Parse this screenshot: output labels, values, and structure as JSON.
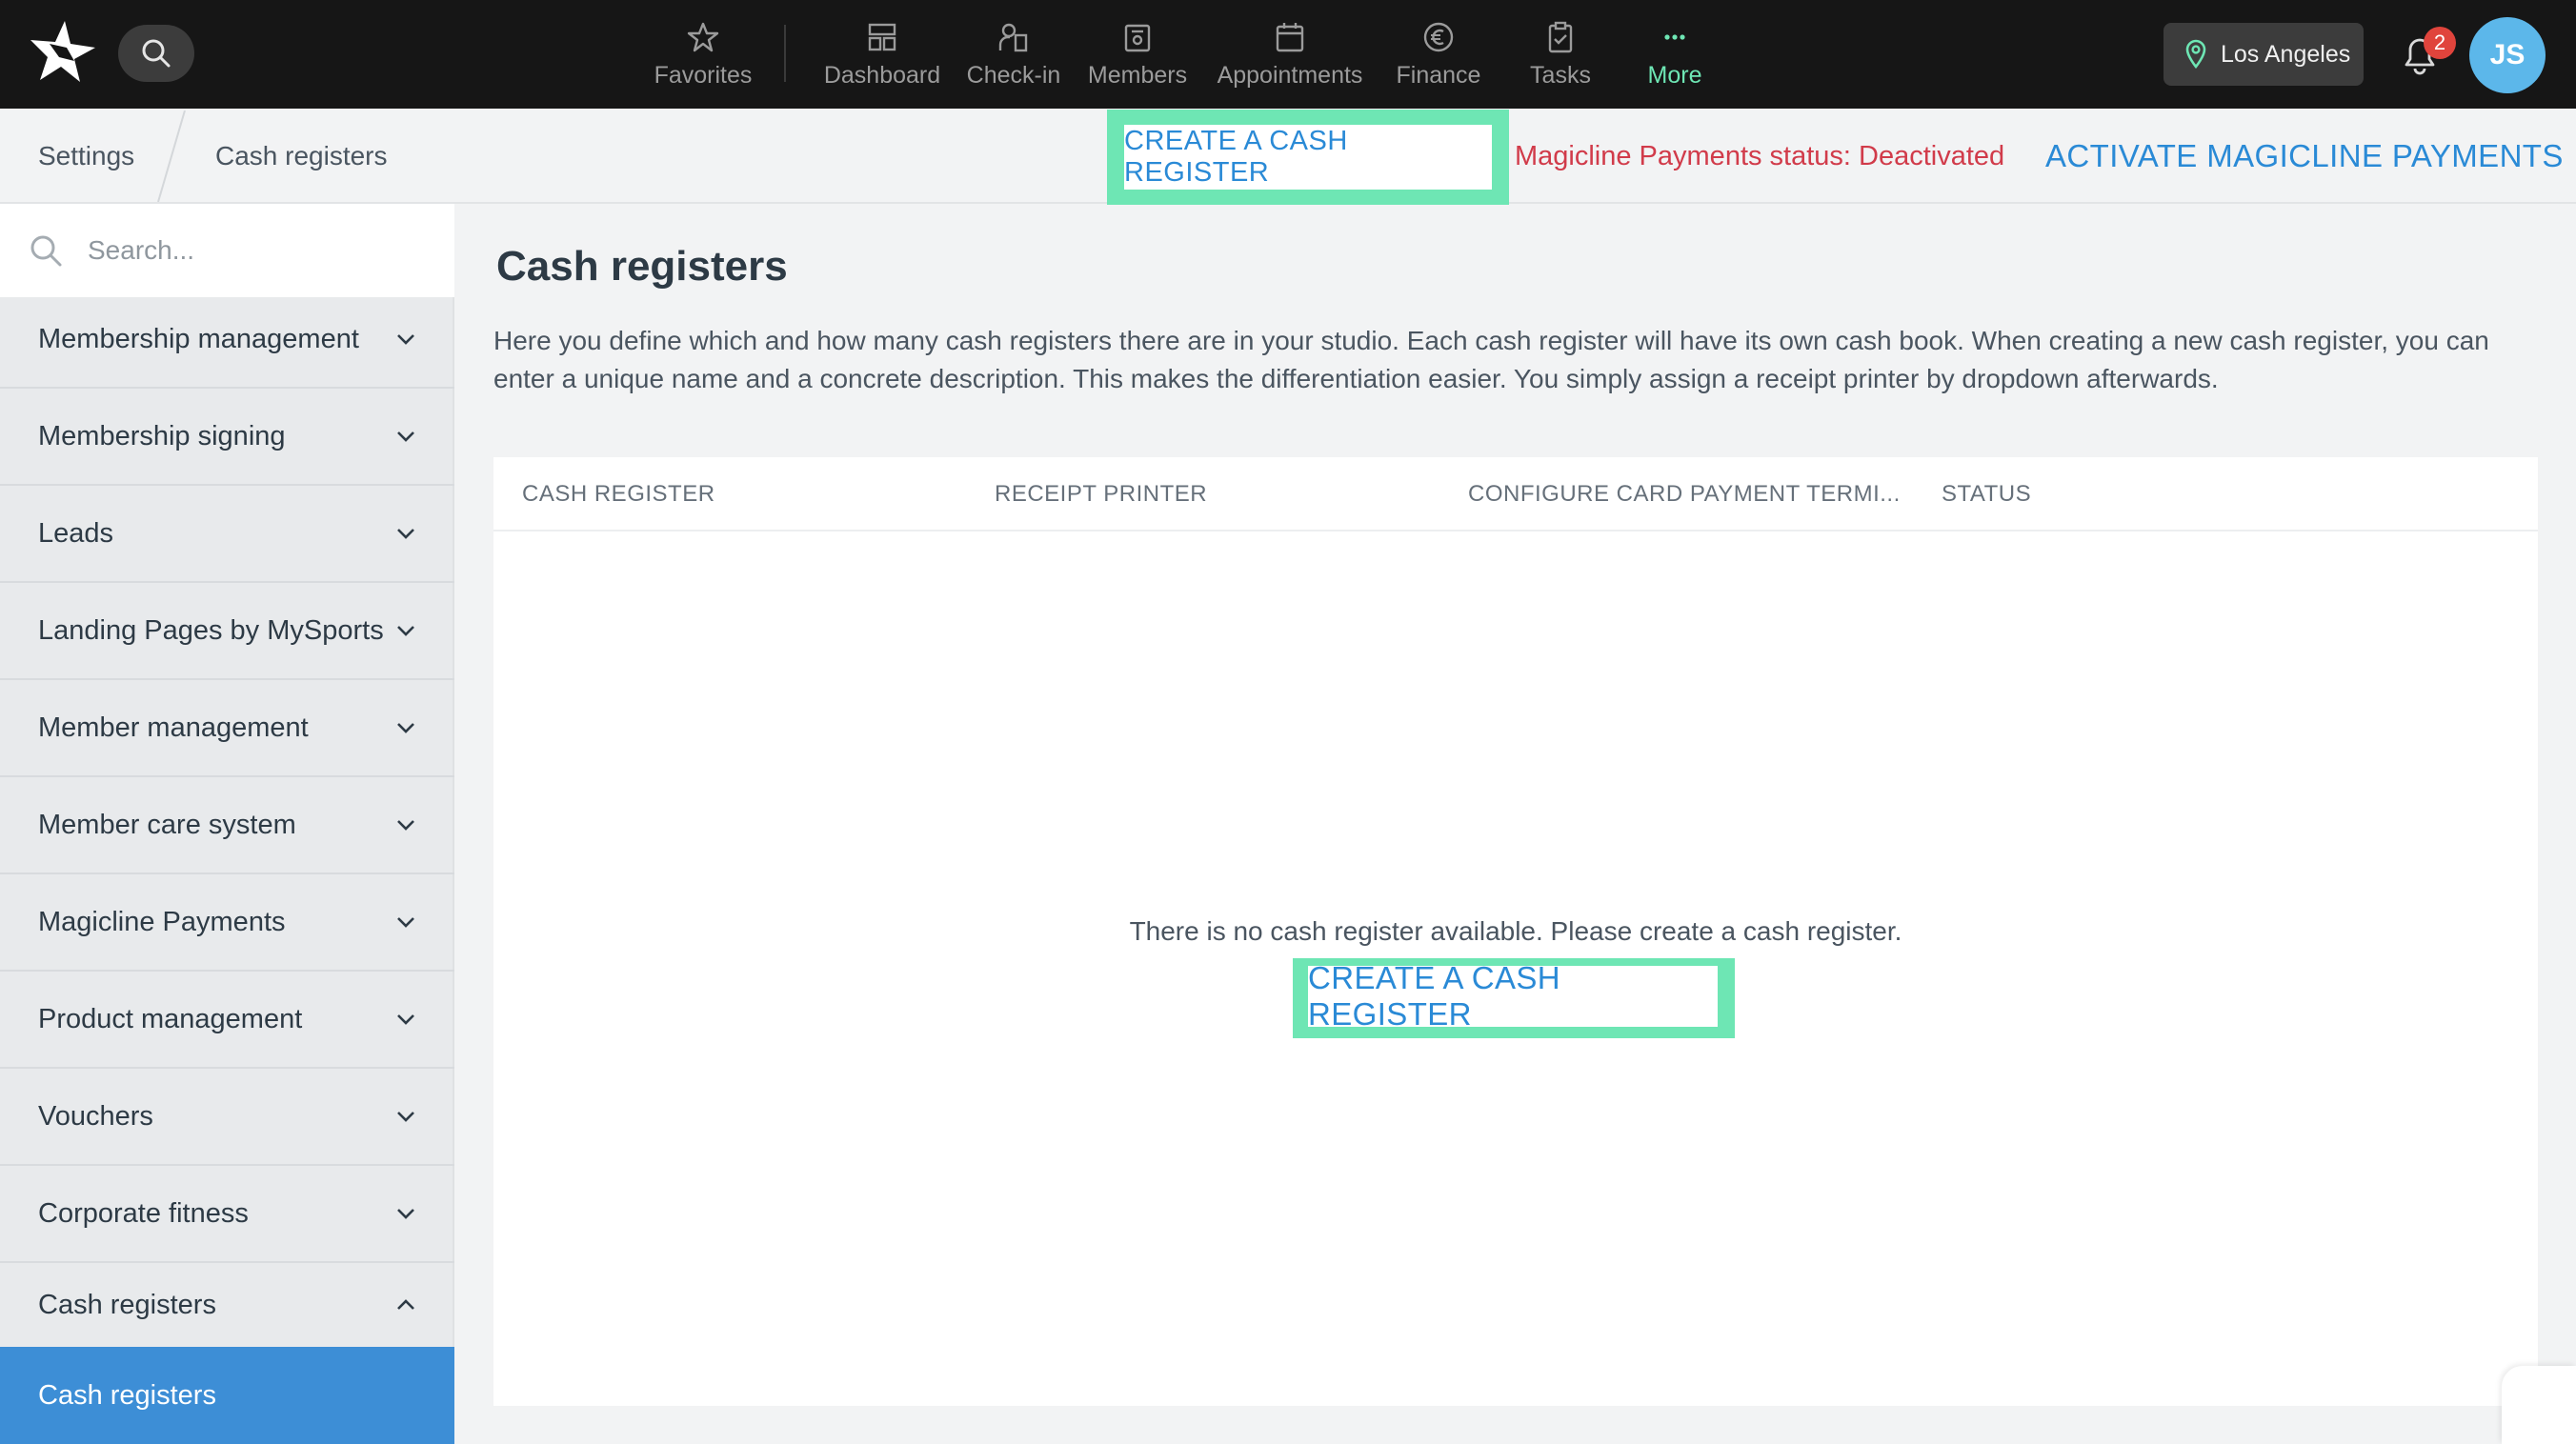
{
  "topbar": {
    "nav": [
      {
        "label": "Favorites"
      },
      {
        "label": "Dashboard"
      },
      {
        "label": "Check-in"
      },
      {
        "label": "Members"
      },
      {
        "label": "Appointments"
      },
      {
        "label": "Finance"
      },
      {
        "label": "Tasks"
      },
      {
        "label": "More"
      }
    ],
    "location": "Los Angeles",
    "notification_count": "2",
    "avatar_initials": "JS",
    "accent_color": "#6ee6b4"
  },
  "breadcrumb": {
    "items": [
      "Settings",
      "Cash registers"
    ]
  },
  "actions": {
    "create_top": "CREATE A CASH REGISTER",
    "payment_status": "Magicline Payments status: Deactivated",
    "activate": "ACTIVATE MAGICLINE PAYMENTS"
  },
  "sidebar": {
    "search_placeholder": "Search...",
    "items": [
      {
        "label": "Membership management",
        "expanded": false
      },
      {
        "label": "Membership signing",
        "expanded": false
      },
      {
        "label": "Leads",
        "expanded": false
      },
      {
        "label": "Landing Pages by MySports",
        "expanded": false
      },
      {
        "label": "Member management",
        "expanded": false
      },
      {
        "label": "Member care system",
        "expanded": false
      },
      {
        "label": "Magicline Payments",
        "expanded": false
      },
      {
        "label": "Product management",
        "expanded": false
      },
      {
        "label": "Vouchers",
        "expanded": false
      },
      {
        "label": "Corporate fitness",
        "expanded": false
      },
      {
        "label": "Cash registers",
        "expanded": true
      }
    ],
    "active_subitem": "Cash registers"
  },
  "main": {
    "title": "Cash registers",
    "intro": "Here you define which and how many cash registers there are in your studio. Each cash register will have its own cash book. When creating a new cash register, you can enter a unique name and a concrete description. This makes the differentiation easier. You simply assign a receipt printer by dropdown afterwards.",
    "columns": [
      "CASH REGISTER",
      "RECEIPT PRINTER",
      "CONFIGURE CARD PAYMENT TERMI...",
      "STATUS"
    ],
    "empty_message": "There is no cash register available. Please create a cash register.",
    "create_button": "CREATE A CASH REGISTER"
  }
}
